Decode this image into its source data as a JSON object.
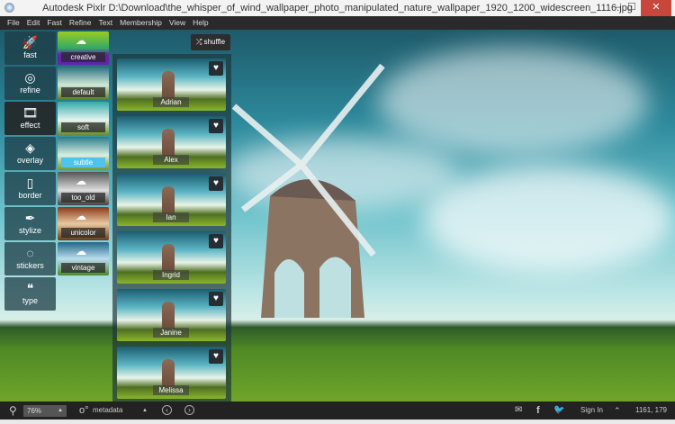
{
  "window": {
    "title": "Autodesk Pixlr   D:\\Download\\the_whisper_of_wind_wallpaper_photo_manipulated_nature_wallpaper_1920_1200_widescreen_1116.jpg",
    "minimize": "–",
    "maximize": "☐",
    "close": "✕"
  },
  "menu": [
    "File",
    "Edit",
    "Fast",
    "Refine",
    "Text",
    "Membership",
    "View",
    "Help"
  ],
  "tools": [
    {
      "label": "fast",
      "icon": "🚀"
    },
    {
      "label": "refine",
      "icon": "◎"
    },
    {
      "label": "effect",
      "icon": "🎞"
    },
    {
      "label": "overlay",
      "icon": "◈"
    },
    {
      "label": "border",
      "icon": "▯"
    },
    {
      "label": "stylize",
      "icon": "✒"
    },
    {
      "label": "stickers",
      "icon": "◌"
    },
    {
      "label": "type",
      "icon": "❝"
    }
  ],
  "filters": [
    {
      "label": "creative",
      "download": true
    },
    {
      "label": "default",
      "download": false
    },
    {
      "label": "soft",
      "download": false
    },
    {
      "label": "subtle",
      "download": false,
      "selected": true
    },
    {
      "label": "too_old",
      "download": true
    },
    {
      "label": "unicolor",
      "download": true
    },
    {
      "label": "vintage",
      "download": true
    }
  ],
  "shuffle_label": "shuffle",
  "effects": [
    "Adrian",
    "Alex",
    "Ian",
    "Ingrid",
    "Janine",
    "Melissa"
  ],
  "statusbar": {
    "zoom": "76%",
    "metadata": "metadata",
    "sign_in": "Sign In",
    "coords": "1161, 179"
  },
  "colors": {
    "accent": "#4ec3ef",
    "close": "#c9463d"
  }
}
